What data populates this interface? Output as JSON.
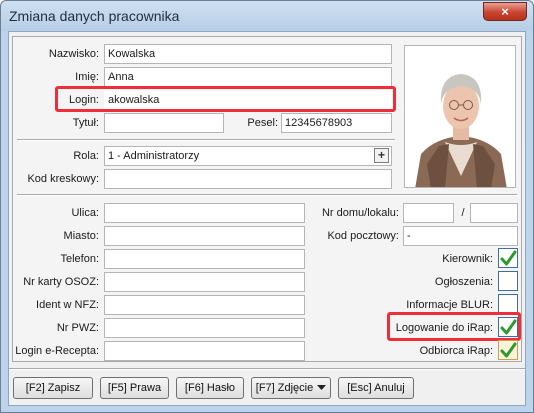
{
  "window": {
    "title": "Zmiana danych pracownika",
    "close_glyph": "×"
  },
  "form": {
    "nazwisko": {
      "label": "Nazwisko:",
      "value": "Kowalska"
    },
    "imie": {
      "label": "Imię:",
      "value": "Anna"
    },
    "login": {
      "label": "Login:",
      "value": "akowalska"
    },
    "tytul": {
      "label": "Tytuł:",
      "value": ""
    },
    "pesel": {
      "label": "Pesel:",
      "value": "12345678903"
    },
    "rola": {
      "label": "Rola:",
      "value": "1 - Administratorzy",
      "button_glyph": "+"
    },
    "kod_kreskowy": {
      "label": "Kod kreskowy:",
      "value": ""
    },
    "ulica": {
      "label": "Ulica:",
      "value": ""
    },
    "miasto": {
      "label": "Miasto:",
      "value": ""
    },
    "telefon": {
      "label": "Telefon:",
      "value": ""
    },
    "nr_karty_osoz": {
      "label": "Nr karty OSOZ:",
      "value": ""
    },
    "ident_nfz": {
      "label": "Ident w NFZ:",
      "value": ""
    },
    "nr_pwz": {
      "label": "Nr PWZ:",
      "value": ""
    },
    "login_erecepta": {
      "label": "Login e-Recepta:",
      "value": ""
    },
    "nr_domu": {
      "label": "Nr domu/lokalu:",
      "value": "",
      "separator": "/",
      "value2": ""
    },
    "kod_pocztowy": {
      "label": "Kod pocztowy:",
      "value": "-"
    }
  },
  "checkboxes": [
    {
      "label": "Kierownik:",
      "checked": true
    },
    {
      "label": "Ogłoszenia:",
      "checked": false
    },
    {
      "label": "Informacje BLUR:",
      "checked": false
    },
    {
      "label": "Logowanie do iRap:",
      "checked": true
    },
    {
      "label": "Odbiorca iRap:",
      "checked": true
    }
  ],
  "buttons": {
    "zapisz": "[F2] Zapisz",
    "prawa": "[F5] Prawa",
    "haslo": "[F6] Hasło",
    "zdjecie": "[F7] Zdjęcie",
    "anuluj": "[Esc] Anuluj"
  },
  "colors": {
    "highlight": "#ee2f3a",
    "check_green": "#2e9a2e",
    "accent_border": "#3c6ea4"
  }
}
